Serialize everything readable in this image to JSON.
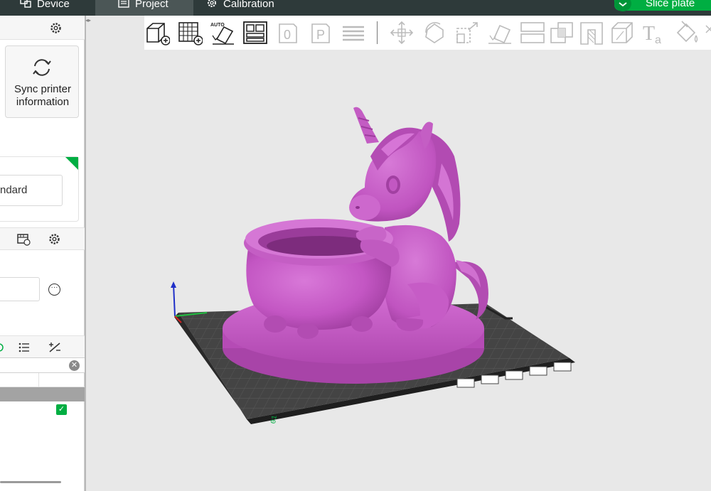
{
  "tabs": {
    "device": "Device",
    "project": "Project",
    "calibration": "Calibration"
  },
  "actions": {
    "slice_plate": "Slice plate"
  },
  "sidebar": {
    "sync_printer_line1": "Sync printer",
    "sync_printer_line2": "information",
    "plate_type_value": "ndard",
    "more_symbol": "···",
    "clear_symbol": "✕",
    "checked_symbol": "✓"
  },
  "colors": {
    "accent": "#00ae42",
    "topbar": "#2e3a3a",
    "model": "#c95bc9",
    "viewport_bg": "#e8e8e8"
  },
  "toolbar_icons": [
    "add-object-icon",
    "add-plate-icon",
    "auto-orient-icon",
    "arrange-icon",
    "plate-0-icon",
    "plate-p-icon",
    "layers-icon",
    "move-icon",
    "rotate-icon",
    "scale-icon",
    "lay-on-face-icon",
    "cut-icon",
    "boolean-icon",
    "support-paint-icon",
    "seam-paint-icon",
    "measure-icon",
    "text-icon",
    "color-paint-icon"
  ]
}
